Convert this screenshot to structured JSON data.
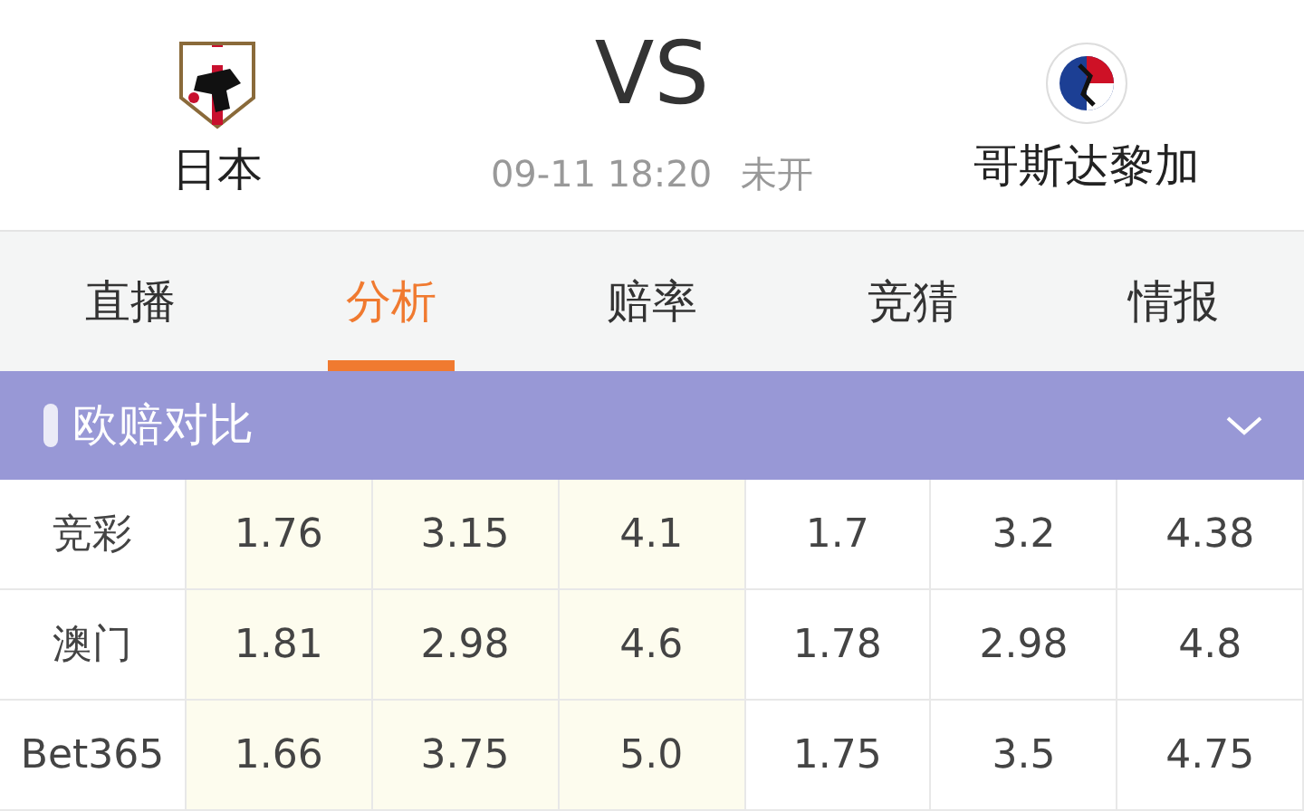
{
  "match": {
    "home": "日本",
    "vs": "VS",
    "time": "09-11 18:20",
    "status": "未开",
    "away": "哥斯达黎加"
  },
  "tabs": [
    {
      "label": "直播",
      "selected": false
    },
    {
      "label": "分析",
      "selected": true
    },
    {
      "label": "赔率",
      "selected": false
    },
    {
      "label": "竞猜",
      "selected": false
    },
    {
      "label": "情报",
      "selected": false
    }
  ],
  "section": {
    "title": "欧赔对比"
  },
  "table": {
    "columns": [
      {
        "highlighted": false
      },
      {
        "highlighted": true
      },
      {
        "highlighted": true
      },
      {
        "highlighted": true
      },
      {
        "highlighted": false
      },
      {
        "highlighted": false
      },
      {
        "highlighted": false
      }
    ],
    "rows": [
      [
        "竞彩",
        "1.76",
        "3.15",
        "4.1",
        "1.7",
        "3.2",
        "4.38"
      ],
      [
        "澳门",
        "1.81",
        "2.98",
        "4.6",
        "1.78",
        "2.98",
        "4.8"
      ],
      [
        "Bet365",
        "1.66",
        "3.75",
        "5.0",
        "1.75",
        "3.5",
        "4.75"
      ]
    ]
  }
}
